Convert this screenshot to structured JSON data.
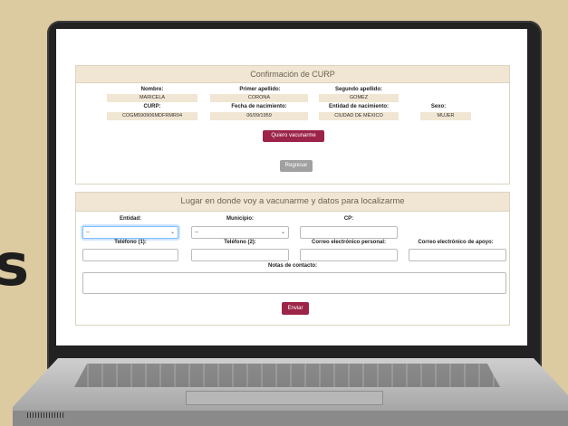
{
  "side_letter": "s",
  "confirm": {
    "title": "Confirmación de CURP",
    "nombre_label": "Nombre:",
    "nombre": "MARICELA",
    "primer_label": "Primer apellido:",
    "primer": "CORONA",
    "segundo_label": "Segundo apellido:",
    "segundo": "GOMEZ",
    "curp_label": "CURP:",
    "curp": "COGM590906MDFRMR04",
    "fecha_label": "Fecha de nacimiento:",
    "fecha": "06/09/1959",
    "entidad_label": "Entidad de nacimiento:",
    "entidad": "CIUDAD DE MÉXICO",
    "sexo_label": "Sexo:",
    "sexo": "MUJER",
    "vacunarme_btn": "Quiero vacunarme",
    "regresar_btn": "Regresar"
  },
  "location": {
    "title": "Lugar en donde voy a vacunarme y datos para localizarme",
    "entidad_label": "Entidad:",
    "entidad_value": "--",
    "municipio_label": "Municipio:",
    "municipio_value": "--",
    "cp_label": "CP:",
    "tel1_label": "Teléfono (1):",
    "tel2_label": "Teléfono (2):",
    "email_label": "Correo electrónico personal:",
    "email_apoyo_label": "Correo electrónico de apoyo:",
    "notas_label": "Notas de contacto:",
    "enviar_btn": "Enviar"
  },
  "colors": {
    "accent": "#9d2449",
    "panel_header": "#f0e6d3",
    "background": "#dccaa1"
  }
}
